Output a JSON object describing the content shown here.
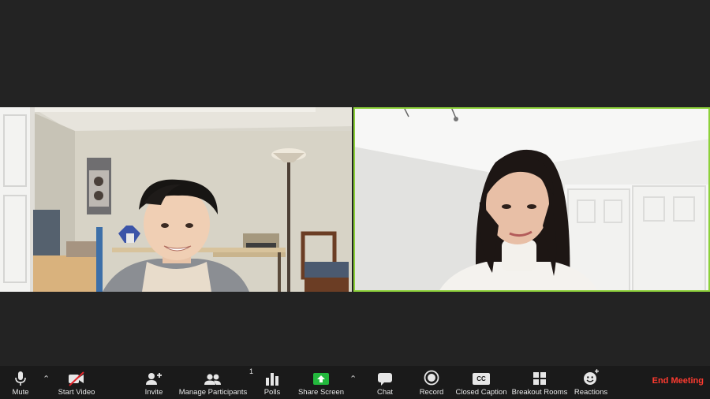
{
  "toolbar": {
    "mute": "Mute",
    "start_video": "Start Video",
    "invite": "Invite",
    "manage_participants": "Manage Participants",
    "participant_count": "1",
    "polls": "Polls",
    "share_screen": "Share Screen",
    "chat": "Chat",
    "record": "Record",
    "closed_caption": "Closed Caption",
    "cc_icon_text": "CC",
    "breakout_rooms": "Breakout Rooms",
    "reactions": "Reactions",
    "end_meeting": "End Meeting"
  },
  "colors": {
    "active_speaker_border": "#8dd13a",
    "share_screen_green": "#23b83d",
    "end_meeting_red": "#ff3b30",
    "toolbar_bg": "#1a1a1a"
  },
  "icons": [
    "microphone-icon",
    "video-off-icon",
    "add-person-icon",
    "participants-icon",
    "polls-icon",
    "share-screen-icon",
    "chat-icon",
    "record-icon",
    "cc-icon",
    "breakout-rooms-icon",
    "reactions-icon"
  ]
}
